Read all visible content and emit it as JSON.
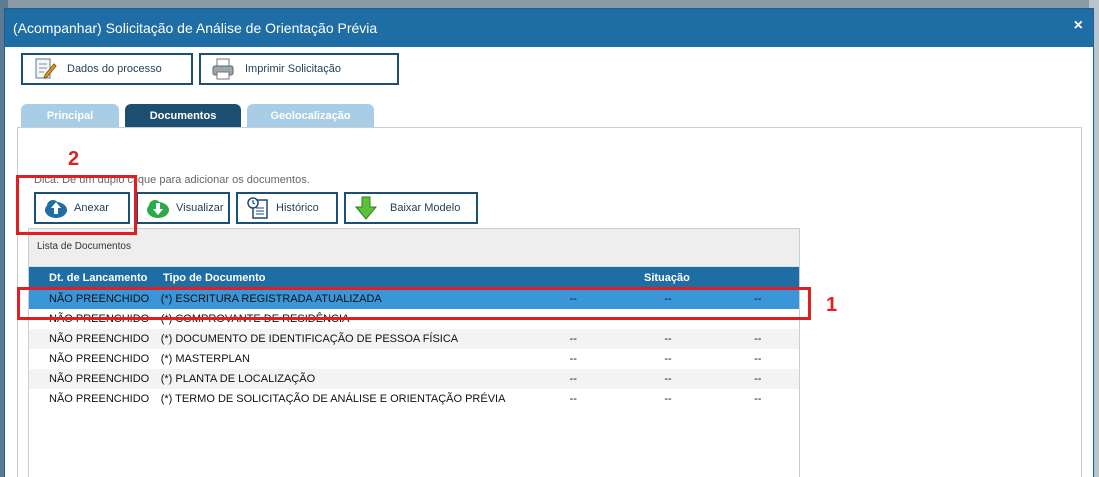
{
  "dialog": {
    "title": "(Acompanhar) Solicitação de Análise de Orientação Prévia",
    "close": "×"
  },
  "toolbar": {
    "dados_label": "Dados do processo",
    "imprimir_label": "Imprimir Solicitação"
  },
  "tabs": [
    {
      "label": "Principal"
    },
    {
      "label": "Documentos"
    },
    {
      "label": "Geolocalização"
    }
  ],
  "hint": {
    "text": "Dica: Dê um duplo clique para adicionar os documentos."
  },
  "actions": {
    "anexar": "Anexar",
    "visualizar": "Visualizar",
    "historico": "Histórico",
    "baixar": "Baixar Modelo"
  },
  "list": {
    "caption": "Lista de Documentos",
    "headers": {
      "dt": "Dt. de Lancamento",
      "tipo": "Tipo de Documento",
      "situacao": "Situação"
    },
    "rows": [
      {
        "dt": "NÃO PREENCHIDO",
        "tipo": "(*) ESCRITURA REGISTRADA ATUALIZADA",
        "a": "--",
        "b": "--",
        "c": "--"
      },
      {
        "dt": "NÃO PREENCHIDO",
        "tipo": "(*) COMPROVANTE DE RESIDÊNCIA",
        "a": "--",
        "b": "--",
        "c": "--"
      },
      {
        "dt": "NÃO PREENCHIDO",
        "tipo": "(*) DOCUMENTO DE IDENTIFICAÇÃO DE PESSOA FÍSICA",
        "a": "--",
        "b": "--",
        "c": "--"
      },
      {
        "dt": "NÃO PREENCHIDO",
        "tipo": "(*) MASTERPLAN",
        "a": "--",
        "b": "--",
        "c": "--"
      },
      {
        "dt": "NÃO PREENCHIDO",
        "tipo": "(*) PLANTA DE LOCALIZAÇÃO",
        "a": "--",
        "b": "--",
        "c": "--"
      },
      {
        "dt": "NÃO PREENCHIDO",
        "tipo": "(*) TERMO DE SOLICITAÇÃO DE ANÁLISE E ORIENTAÇÃO PRÉVIA",
        "a": "--",
        "b": "--",
        "c": "--"
      }
    ]
  },
  "annotations": {
    "one": "1",
    "two": "2"
  },
  "colors": {
    "title_bar": "#1f6da5",
    "selected_row": "#3a96d8",
    "annotation": "#e02020"
  }
}
